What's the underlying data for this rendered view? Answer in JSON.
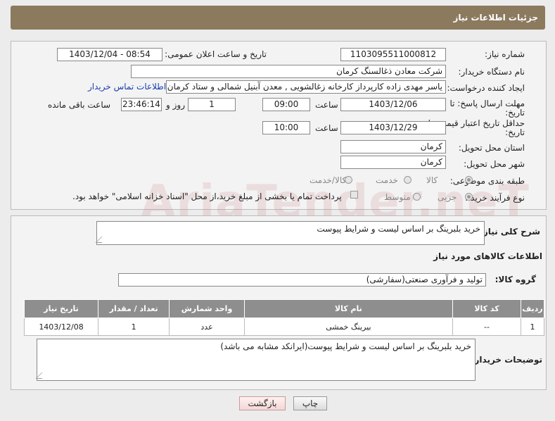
{
  "header": {
    "title": "جزئیات اطلاعات نیاز"
  },
  "form": {
    "need_number_label": "شماره نیاز:",
    "need_number": "1103095511000812",
    "announce_label": "تاریخ و ساعت اعلان عمومی:",
    "announce_value": "1403/12/04 - 08:54",
    "buyer_org_label": "نام دستگاه خریدار:",
    "buyer_org": "شرکت معادن ذغالسنگ کرمان",
    "creator_label": "ایجاد کننده درخواست:",
    "creator": "یاسر مهدی زاده کارپرداز کارخانه زغالشویی , معدن آبنیل شمالی و ستاد کرمان ،",
    "contact_link": "اطلاعات تماس خریدار",
    "deadline_label": "مهلت ارسال پاسخ: تا",
    "deadline_label2": "تاریخ:",
    "deadline_date": "1403/12/06",
    "time_label": "ساعت",
    "deadline_time": "09:00",
    "days_value": "1",
    "days_label": "روز و",
    "remaining_time": "23:46:14",
    "remaining_label": "ساعت باقی مانده",
    "validity_label": "حداقل تاریخ اعتبار قیمت: تا",
    "validity_label2": "تاریخ:",
    "validity_date": "1403/12/29",
    "validity_time": "10:00",
    "province_label": "استان محل تحویل:",
    "province": "کرمان",
    "city_label": "شهر محل تحویل:",
    "city": "کرمان",
    "category_label": "طبقه بندی موضوعی:",
    "category_options": [
      "کالا",
      "خدمت",
      "کالا/خدمت"
    ],
    "process_label": "نوع فرآیند خرید :",
    "process_options": [
      "جزیی",
      "متوسط"
    ],
    "payment_note": "پرداخت تمام یا بخشی از مبلغ خرید،از محل \"اسناد خزانه اسلامی\" خواهد بود."
  },
  "details": {
    "desc_label": "شرح کلی نیاز:",
    "desc": "خرید بلبرینگ بر اساس لیست و شرایط پیوست",
    "goods_info_title": "اطلاعات کالاهای مورد نیاز",
    "goods_group_label": "گروه کالا:",
    "goods_group": "تولید و فرآوری صنعتی(سفارشی)",
    "table": {
      "headers": [
        "ردیف",
        "کد کالا",
        "نام کالا",
        "واحد شمارش",
        "تعداد / مقدار",
        "تاریخ نیاز"
      ],
      "rows": [
        [
          "1",
          "--",
          "بیرینگ خمشی",
          "عدد",
          "1",
          "1403/12/08"
        ]
      ]
    },
    "buyer_notes_label": "توضیحات خریدار:",
    "buyer_notes": "خرید بلبرینگ بر اساس لیست و شرایط پیوست(ایرانکد مشابه می باشد)"
  },
  "buttons": {
    "print": "چاپ",
    "back": "بازگشت"
  },
  "watermark": "AriaTender.neT"
}
